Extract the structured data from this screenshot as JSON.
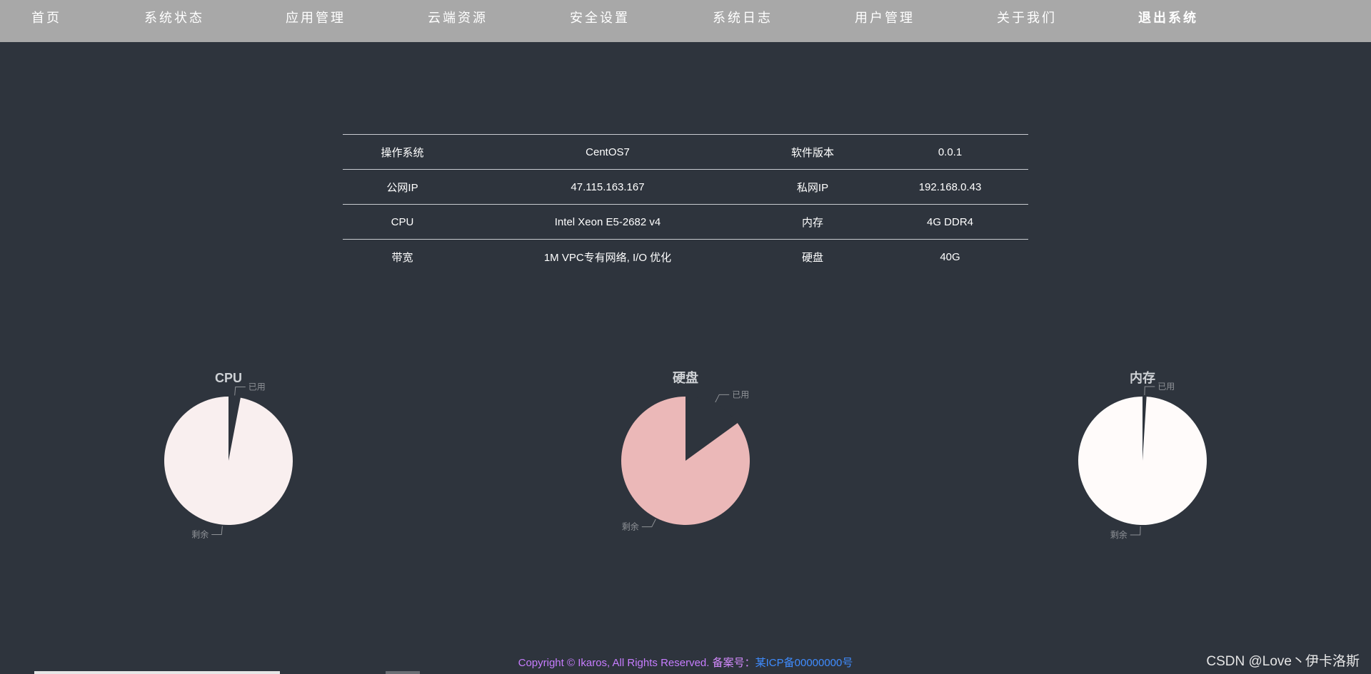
{
  "nav": {
    "items": [
      {
        "label": "首页"
      },
      {
        "label": "系统状态"
      },
      {
        "label": "应用管理"
      },
      {
        "label": "云端资源"
      },
      {
        "label": "安全设置"
      },
      {
        "label": "系统日志"
      },
      {
        "label": "用户管理"
      },
      {
        "label": "关于我们"
      },
      {
        "label": "退出系统"
      }
    ]
  },
  "info": {
    "rows": [
      [
        "操作系统",
        "CentOS7",
        "软件版本",
        "0.0.1"
      ],
      [
        "公网IP",
        "47.115.163.167",
        "私网IP",
        "192.168.0.43"
      ],
      [
        "CPU",
        "Intel Xeon E5-2682 v4",
        "内存",
        "4G DDR4"
      ],
      [
        "带宽",
        "1M VPC专有网络, I/O 优化",
        "硬盘",
        "40G"
      ]
    ]
  },
  "chart_data": [
    {
      "type": "pie",
      "title": "CPU",
      "categories": [
        "已用",
        "剩余"
      ],
      "values": [
        3,
        97
      ],
      "colors": [
        "#2e343d",
        "#f9efef"
      ]
    },
    {
      "type": "pie",
      "title": "硬盘",
      "categories": [
        "已用",
        "剩余"
      ],
      "values": [
        15,
        85
      ],
      "colors": [
        "#2e343d",
        "#ebb8b8"
      ]
    },
    {
      "type": "pie",
      "title": "内存",
      "categories": [
        "已用",
        "剩余"
      ],
      "values": [
        1,
        99
      ],
      "colors": [
        "#2e343d",
        "#fffbfa"
      ]
    }
  ],
  "footer": {
    "copyright": "Copyright © Ikaros, All Rights Reserved.",
    "icp_label": "备案号：",
    "icp": "某ICP备00000000号"
  },
  "watermark": "CSDN @Love丶伊卡洛斯",
  "colors": {
    "page_bg": "#2e343d",
    "nav_bg": "#a8a8a8",
    "label_text": "#8e9196",
    "title_text": "#cfd2d6"
  }
}
